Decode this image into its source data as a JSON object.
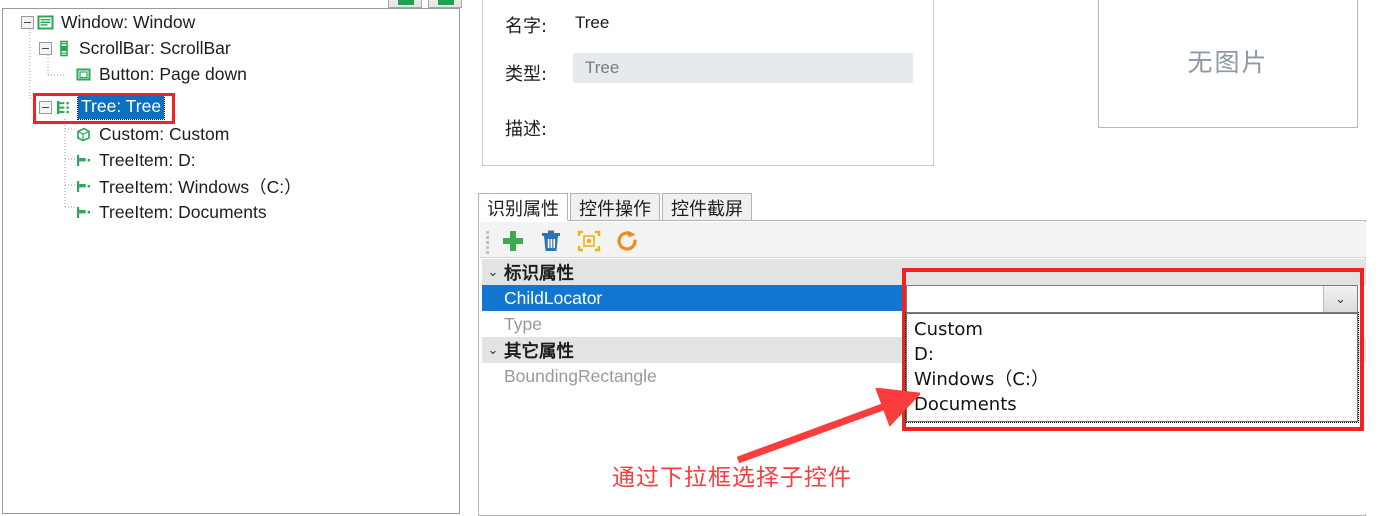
{
  "tree_toolbar": {
    "buttons": [
      {
        "name": "toolbar-button-1",
        "label": ""
      },
      {
        "name": "toolbar-button-2",
        "label": ""
      }
    ]
  },
  "tree": {
    "nodes": [
      {
        "label": "Window: Window",
        "icon": "window-icon",
        "depth": 0,
        "expander": "collapse",
        "selected": false
      },
      {
        "label": "ScrollBar: ScrollBar",
        "icon": "scrollbar-icon",
        "depth": 1,
        "expander": "collapse",
        "selected": false
      },
      {
        "label": "Button: Page down",
        "icon": "button-icon",
        "depth": 2,
        "expander": "none",
        "selected": false
      },
      {
        "label": "Tree: Tree",
        "icon": "tree-icon",
        "depth": 1,
        "expander": "collapse",
        "selected": true
      },
      {
        "label": "Custom: Custom",
        "icon": "custom-icon",
        "depth": 2,
        "expander": "none",
        "selected": false
      },
      {
        "label": "TreeItem: D:",
        "icon": "treeitem-icon",
        "depth": 2,
        "expander": "none",
        "selected": false
      },
      {
        "label": "TreeItem: Windows（C:）",
        "icon": "treeitem-icon",
        "depth": 2,
        "expander": "none",
        "selected": false
      },
      {
        "label": "TreeItem: Documents",
        "icon": "treeitem-icon",
        "depth": 2,
        "expander": "none",
        "selected": false
      }
    ]
  },
  "info_card": {
    "name_label": "名字:",
    "name_value": "Tree",
    "type_label": "类型:",
    "type_value": "Tree",
    "desc_label": "描述:",
    "desc_value": ""
  },
  "image_preview": {
    "placeholder_text": "无图片"
  },
  "tabs": [
    {
      "label": "识别属性",
      "active": true
    },
    {
      "label": "控件操作",
      "active": false
    },
    {
      "label": "控件截屏",
      "active": false
    }
  ],
  "props_toolbar": {
    "icons": [
      {
        "name": "add-icon",
        "glyph": "+",
        "color": "#3faa4c"
      },
      {
        "name": "delete-icon",
        "glyph": "🗑",
        "color": "#2f74b5"
      },
      {
        "name": "capture-icon",
        "glyph": "⛶",
        "color": "#edb317"
      },
      {
        "name": "refresh-icon",
        "glyph": "⟳",
        "color": "#f08a1d"
      }
    ]
  },
  "property_grid": {
    "groups": [
      {
        "title": "标识属性",
        "rows": [
          {
            "name": "ChildLocator",
            "value": "",
            "selected": true
          },
          {
            "name": "Type",
            "value": "",
            "selected": false
          }
        ]
      },
      {
        "title": "其它属性",
        "rows": [
          {
            "name": "BoundingRectangle",
            "value": "",
            "selected": false
          }
        ]
      }
    ]
  },
  "combobox": {
    "value": "",
    "arrow_glyph": "⌄",
    "options": [
      "Custom",
      "D:",
      "Windows（C:）",
      "Documents"
    ]
  },
  "annotation": {
    "text": "通过下拉框选择子控件",
    "color": "#fa3c3c"
  },
  "colors": {
    "selection_blue": "#1177d1",
    "highlight_red": "#f22222",
    "tree_icon_green": "#2aa858",
    "group_header_bg": "#e3e3e3"
  }
}
